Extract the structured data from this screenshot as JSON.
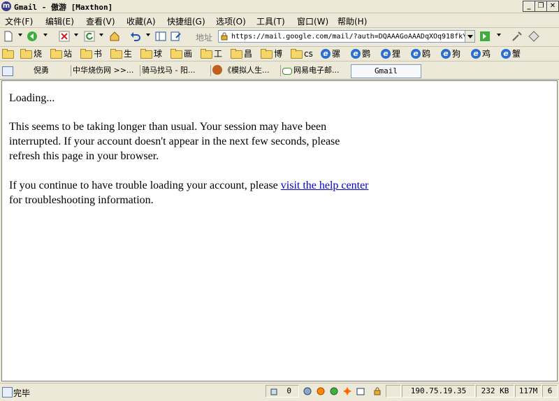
{
  "window": {
    "title": "Gmail - 傲游 [Maxthon]",
    "app_icon": "m"
  },
  "menu": {
    "items": [
      "文件(F)",
      "编辑(E)",
      "查看(V)",
      "收藏(A)",
      "快捷组(G)",
      "选项(O)",
      "工具(T)",
      "窗口(W)",
      "帮助(H)"
    ]
  },
  "toolbar": {
    "address_label": "地址",
    "address_value": "https://mail.google.com/mail/?auth=DQAAAGoAAADqXOq918fk\\"
  },
  "favorites": {
    "items": [
      "",
      "烧",
      "站",
      "书",
      "生",
      "球",
      "画",
      "工",
      "昌",
      "博",
      "cs",
      "骡",
      "鹦",
      "狸",
      "鸥",
      "狗",
      "鸡",
      "蟹"
    ]
  },
  "tabs": {
    "items": [
      "倪勇",
      "中华烧伤网 >>...",
      "骑马找马 - 阳...",
      "《模拟人生...",
      "网易电子邮...",
      "Gmail"
    ]
  },
  "content": {
    "loading": "Loading...",
    "warning_lines": [
      "This seems to be taking longer than usual. Your session may have been",
      "interrupted. If your account doesn't appear in the next few seconds, please",
      "refresh this page in your browser."
    ],
    "trouble_prefix": "If you continue to have trouble loading your account, please ",
    "help_link": "visit the help center",
    "trouble_suffix": "for troubleshooting information."
  },
  "status": {
    "text": "完毕",
    "popup_count": "0",
    "ip": "190.75.19.35",
    "size": "232 KB",
    "memory": "117M",
    "extra": "6"
  }
}
